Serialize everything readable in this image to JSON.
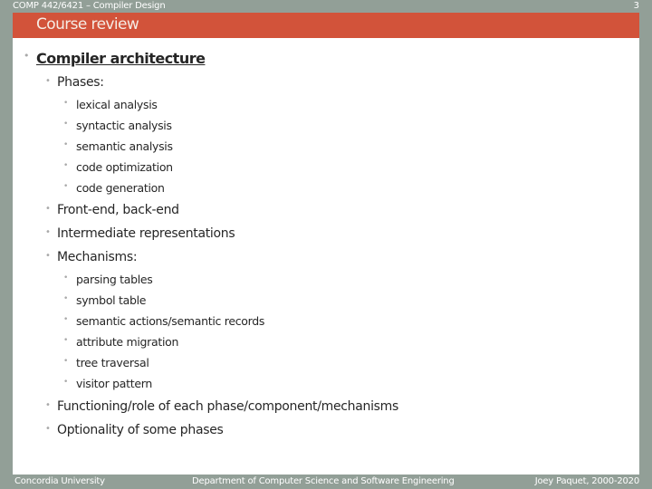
{
  "header": {
    "course": "COMP 442/6421 – Compiler Design",
    "page_number": "3",
    "title": "Course review"
  },
  "content": {
    "heading": "Compiler architecture",
    "phases_label": "Phases:",
    "phases": [
      "lexical analysis",
      "syntactic analysis",
      "semantic analysis",
      "code optimization",
      "code generation"
    ],
    "frontend": "Front-end, back-end",
    "intermediate": "Intermediate representations",
    "mechanisms_label": "Mechanisms:",
    "mechanisms": [
      "parsing tables",
      "symbol table",
      "semantic actions/semantic records",
      "attribute migration",
      "tree traversal",
      "visitor pattern"
    ],
    "functioning": "Functioning/role of each phase/component/mechanisms",
    "optionality": "Optionality of some phases"
  },
  "footer": {
    "left": "Concordia University",
    "center": "Department of Computer Science and Software Engineering",
    "right": "Joey Paquet, 2000-2020"
  },
  "colors": {
    "frame": "#929f97",
    "title_bar": "#d2533a",
    "bullet": "#a9a9a9"
  },
  "bullet_glyph": "•"
}
